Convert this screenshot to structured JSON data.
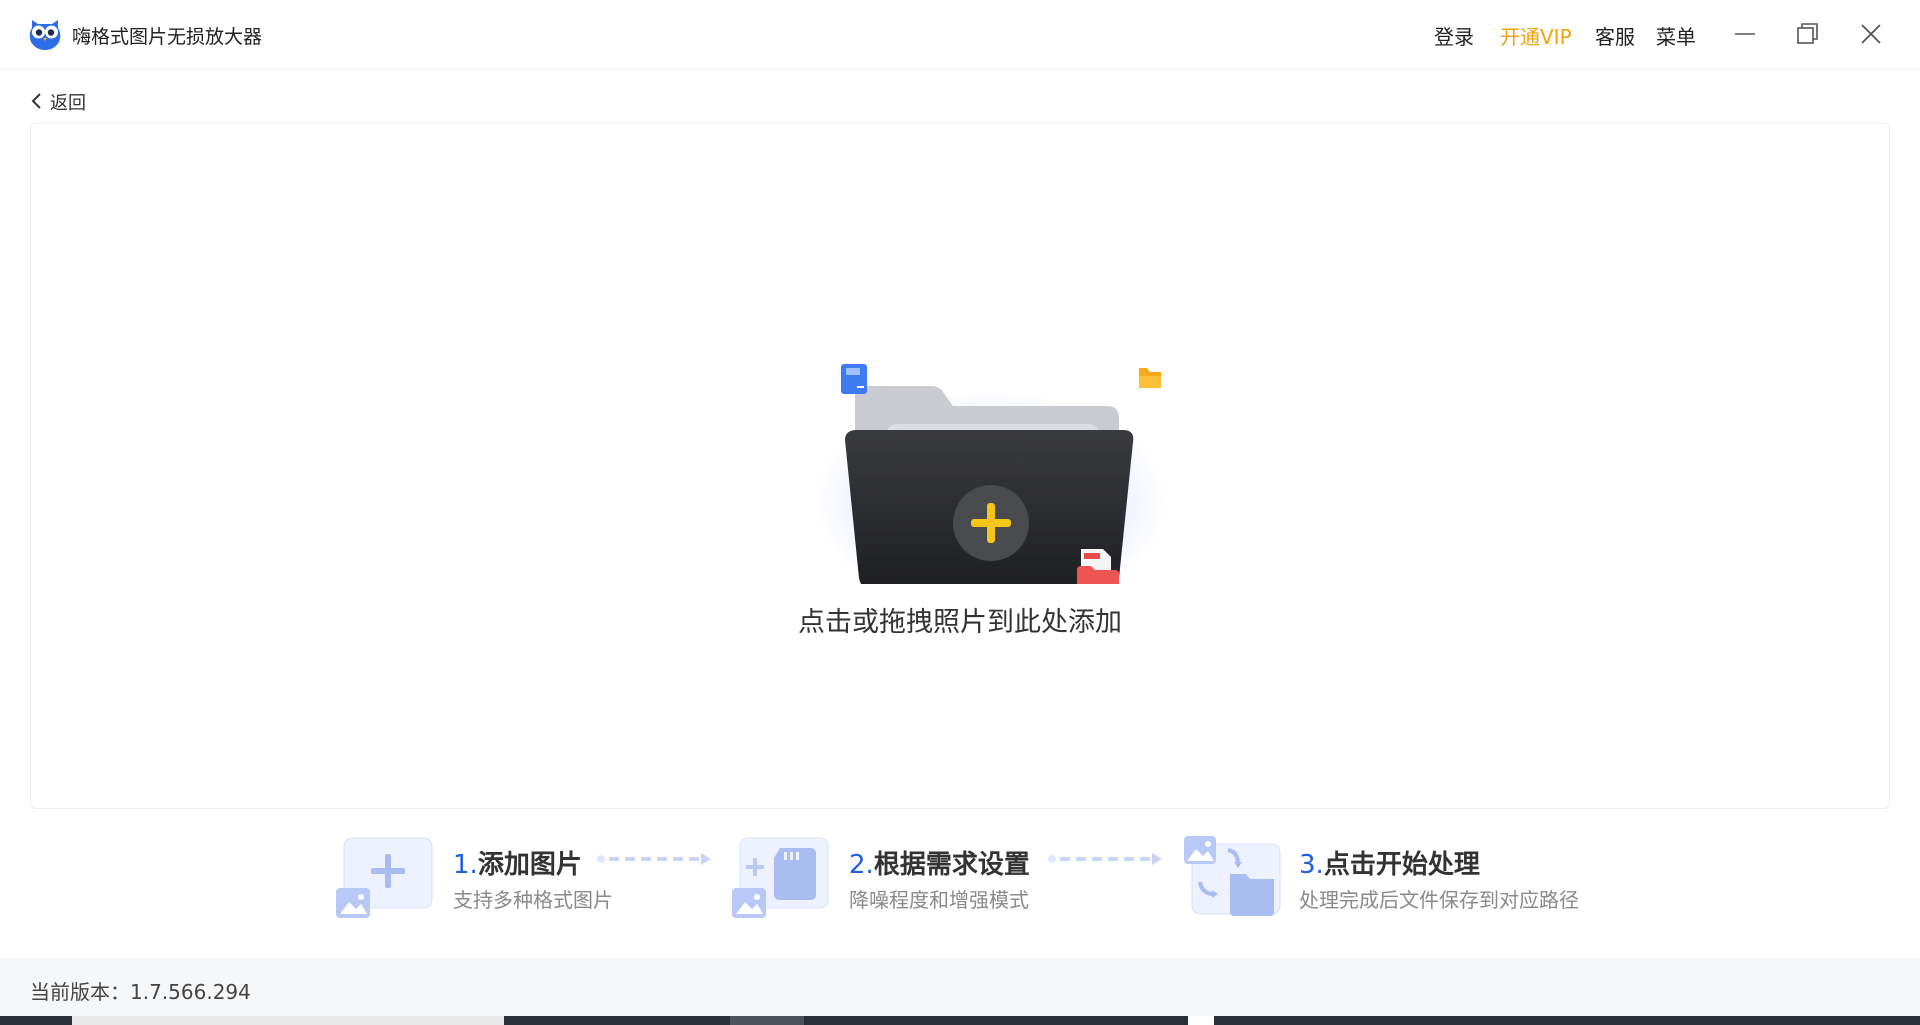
{
  "app": {
    "title": "嗨格式图片无损放大器",
    "logo_icon": "owl-logo-icon"
  },
  "header": {
    "login": "登录",
    "vip": "开通VIP",
    "service": "客服",
    "menu": "菜单",
    "vip_color": "#f2a20d"
  },
  "nav": {
    "back_label": "返回"
  },
  "dropzone": {
    "hint": "点击或拖拽照片到此处添加"
  },
  "steps": [
    {
      "num": "1.",
      "title": "添加图片",
      "desc": "支持多种格式图片"
    },
    {
      "num": "2.",
      "title": "根据需求设置",
      "desc": "降噪程度和增强模式"
    },
    {
      "num": "3.",
      "title": "点击开始处理",
      "desc": "处理完成后文件保存到对应路径"
    }
  ],
  "footer": {
    "version": "当前版本：1.7.566.294"
  },
  "colors": {
    "accent": "#1f5fe0",
    "plus": "#f5c518",
    "folder_dark": "#2f3033"
  }
}
